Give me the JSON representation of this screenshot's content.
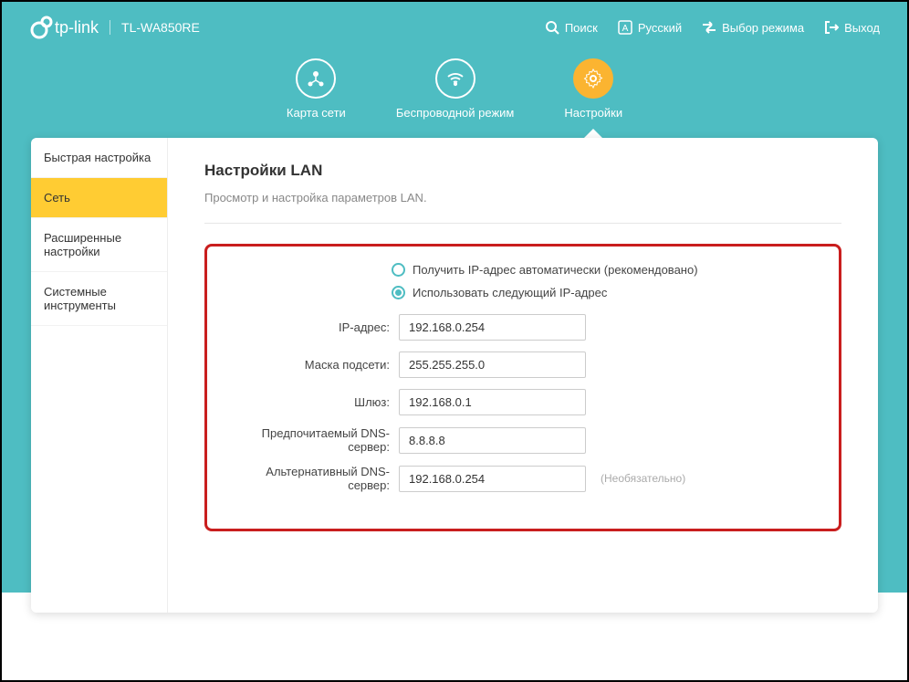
{
  "brand": "tp-link",
  "model": "TL-WA850RE",
  "header": {
    "search": "Поиск",
    "language": "Русский",
    "mode": "Выбор режима",
    "logout": "Выход"
  },
  "tabs": {
    "map": "Карта сети",
    "wireless": "Беспроводной режим",
    "settings": "Настройки"
  },
  "sidebar": {
    "quick": "Быстрая настройка",
    "network": "Сеть",
    "advanced": "Расширенные настройки",
    "system": "Системные инструменты"
  },
  "page": {
    "title": "Настройки LAN",
    "desc": "Просмотр и настройка параметров LAN."
  },
  "radios": {
    "auto": "Получить IP-адрес автоматически (рекомендовано)",
    "manual": "Использовать следующий IP-адрес"
  },
  "fields": {
    "ip_label": "IP-адрес:",
    "ip_value": "192.168.0.254",
    "mask_label": "Маска подсети:",
    "mask_value": "255.255.255.0",
    "gateway_label": "Шлюз:",
    "gateway_value": "192.168.0.1",
    "dns1_label": "Предпочитаемый DNS-сервер:",
    "dns1_value": "8.8.8.8",
    "dns2_label": "Альтернативный DNS-сервер:",
    "dns2_value": "192.168.0.254",
    "optional": "(Необязательно)"
  }
}
